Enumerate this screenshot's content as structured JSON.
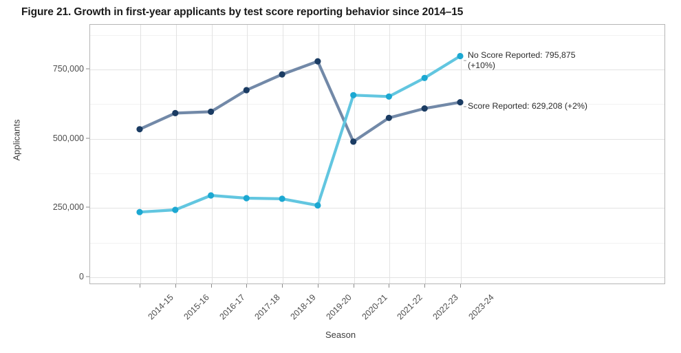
{
  "figure": {
    "title": "Figure 21. Growth in first-year applicants by test score reporting behavior since 2014–15"
  },
  "axes": {
    "y_title": "Applicants",
    "x_title": "Season"
  },
  "annotations": {
    "no_score": "No Score Reported: 795,875\n(+10%)",
    "score": "Score Reported: 629,208 (+2%)"
  },
  "colors": {
    "no_score_line": "#62C6E0",
    "no_score_marker": "#1CA8D2",
    "score_line": "#7289A8",
    "score_marker": "#1B3C63",
    "grid_major": "#e2e2e2",
    "grid_minor": "#f2f2f2",
    "panel_border": "#b5b5b5",
    "text": "#4d4d4d",
    "title_text": "#1a1a1a"
  },
  "chart_data": {
    "type": "line",
    "title": "Figure 21. Growth in first-year applicants by test score reporting behavior since 2014–15",
    "xlabel": "Season",
    "ylabel": "Applicants",
    "categories": [
      "2014-15",
      "2015-16",
      "2016-17",
      "2017-18",
      "2018-19",
      "2019-20",
      "2020-21",
      "2021-22",
      "2022-23",
      "2023-24"
    ],
    "ylim": [
      0,
      850000
    ],
    "yticks": [
      0,
      250000,
      500000,
      750000
    ],
    "ytick_labels": [
      "0",
      "250,000",
      "500,000",
      "750,000"
    ],
    "y_minor_ticks": [
      125000,
      375000,
      625000
    ],
    "grid": true,
    "legend": "annotations-at-line-end",
    "series": [
      {
        "name": "Score Reported",
        "color": "#7289A8",
        "marker_color": "#1B3C63",
        "end_label": "Score Reported: 629,208 (+2%)",
        "values": [
          532000,
          590000,
          595000,
          673000,
          730000,
          777000,
          487000,
          573000,
          607000,
          629208
        ]
      },
      {
        "name": "No Score Reported",
        "color": "#62C6E0",
        "marker_color": "#1CA8D2",
        "end_label": "No Score Reported: 795,875 (+10%)",
        "values": [
          233000,
          241000,
          293000,
          283000,
          281000,
          257000,
          655000,
          650000,
          717000,
          795875
        ]
      }
    ]
  }
}
